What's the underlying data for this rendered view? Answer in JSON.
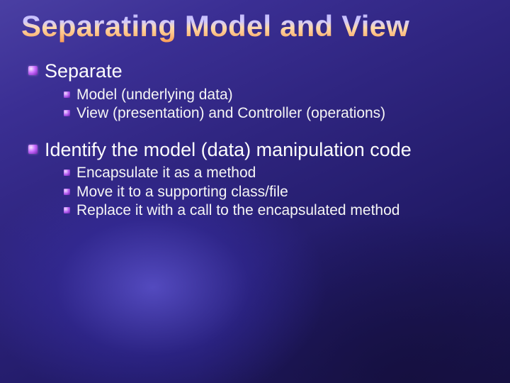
{
  "title": "Separating Model and View",
  "bullets": [
    {
      "text": "Separate",
      "sub": [
        "Model (underlying data)",
        "View (presentation) and Controller (operations)"
      ]
    },
    {
      "text": "Identify the model (data) manipulation code",
      "sub": [
        "Encapsulate it as a method",
        "Move it to a supporting class/file",
        "Replace it with a call to the encapsulated method"
      ]
    }
  ]
}
